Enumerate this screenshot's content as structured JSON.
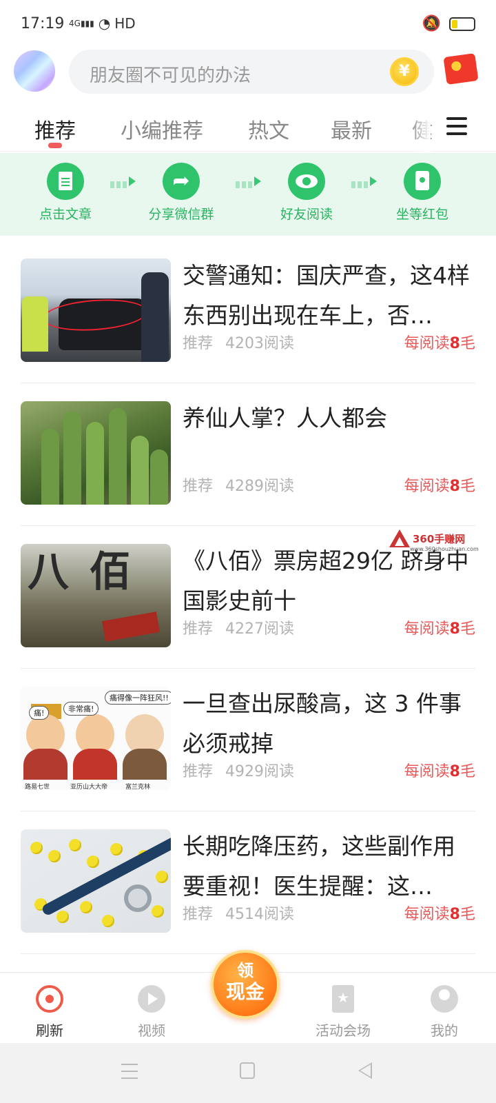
{
  "status_bar": {
    "time": "17:19",
    "network": "4G",
    "wifi_label": "HD",
    "battery_color": "#f2d400"
  },
  "header": {
    "search_placeholder": "朋友圈不可见的办法",
    "coin_glyph": "¥",
    "icons": [
      "avatar",
      "coin-icon",
      "red-packet-icon"
    ]
  },
  "tabs": {
    "items": [
      "推荐",
      "小编推荐",
      "热文",
      "最新",
      "健"
    ],
    "active_index": 0,
    "indicator_color": "#f25c5c"
  },
  "steps": {
    "items": [
      {
        "label": "点击文章",
        "icon": "document-icon"
      },
      {
        "label": "分享微信群",
        "icon": "share-icon"
      },
      {
        "label": "好友阅读",
        "icon": "eye-icon"
      },
      {
        "label": "坐等红包",
        "icon": "red-packet-icon"
      }
    ],
    "accent_color": "#2fc36b"
  },
  "articles": [
    {
      "title": "交警通知：国庆严查，这4样东西别出现在车上，否…",
      "tag": "推荐",
      "reads": "4203阅读",
      "reward_prefix": "每阅读",
      "reward_amount": "8",
      "reward_unit": "毛"
    },
    {
      "title": "养仙人掌？人人都会",
      "tag": "推荐",
      "reads": "4289阅读",
      "reward_prefix": "每阅读",
      "reward_amount": "8",
      "reward_unit": "毛"
    },
    {
      "title": "《八佰》票房超29亿 跻身中国影史前十",
      "tag": "推荐",
      "reads": "4227阅读",
      "reward_prefix": "每阅读",
      "reward_amount": "8",
      "reward_unit": "毛"
    },
    {
      "title": "一旦查出尿酸高，这 3 件事必须戒掉",
      "tag": "推荐",
      "reads": "4929阅读",
      "reward_prefix": "每阅读",
      "reward_amount": "8",
      "reward_unit": "毛"
    },
    {
      "title": "长期吃降压药，这些副作用要重视！医生提醒：这…",
      "tag": "推荐",
      "reads": "4514阅读",
      "reward_prefix": "每阅读",
      "reward_amount": "8",
      "reward_unit": "毛"
    }
  ],
  "thumb_text": {
    "movie_big": "八佰",
    "bubble_1": "痛!",
    "bubble_2": "非常痛!",
    "bubble_3": "痛得像一阵狂风!!",
    "caption_1": "路易七世",
    "caption_2": "亚历山大大帝",
    "caption_3": "富兰克林"
  },
  "watermark": {
    "text": "360手赚网",
    "url": "www.360shouzhuan.com"
  },
  "bottom_nav": {
    "items": [
      {
        "label": "刷新",
        "icon": "refresh-icon"
      },
      {
        "label": "视频",
        "icon": "play-icon"
      },
      {
        "label": "活动会场",
        "icon": "star-icon"
      },
      {
        "label": "我的",
        "icon": "user-icon"
      }
    ],
    "active_index": 0,
    "center_button": {
      "line1": "领",
      "line2": "现金"
    },
    "accent_color": "#f05a4a"
  }
}
